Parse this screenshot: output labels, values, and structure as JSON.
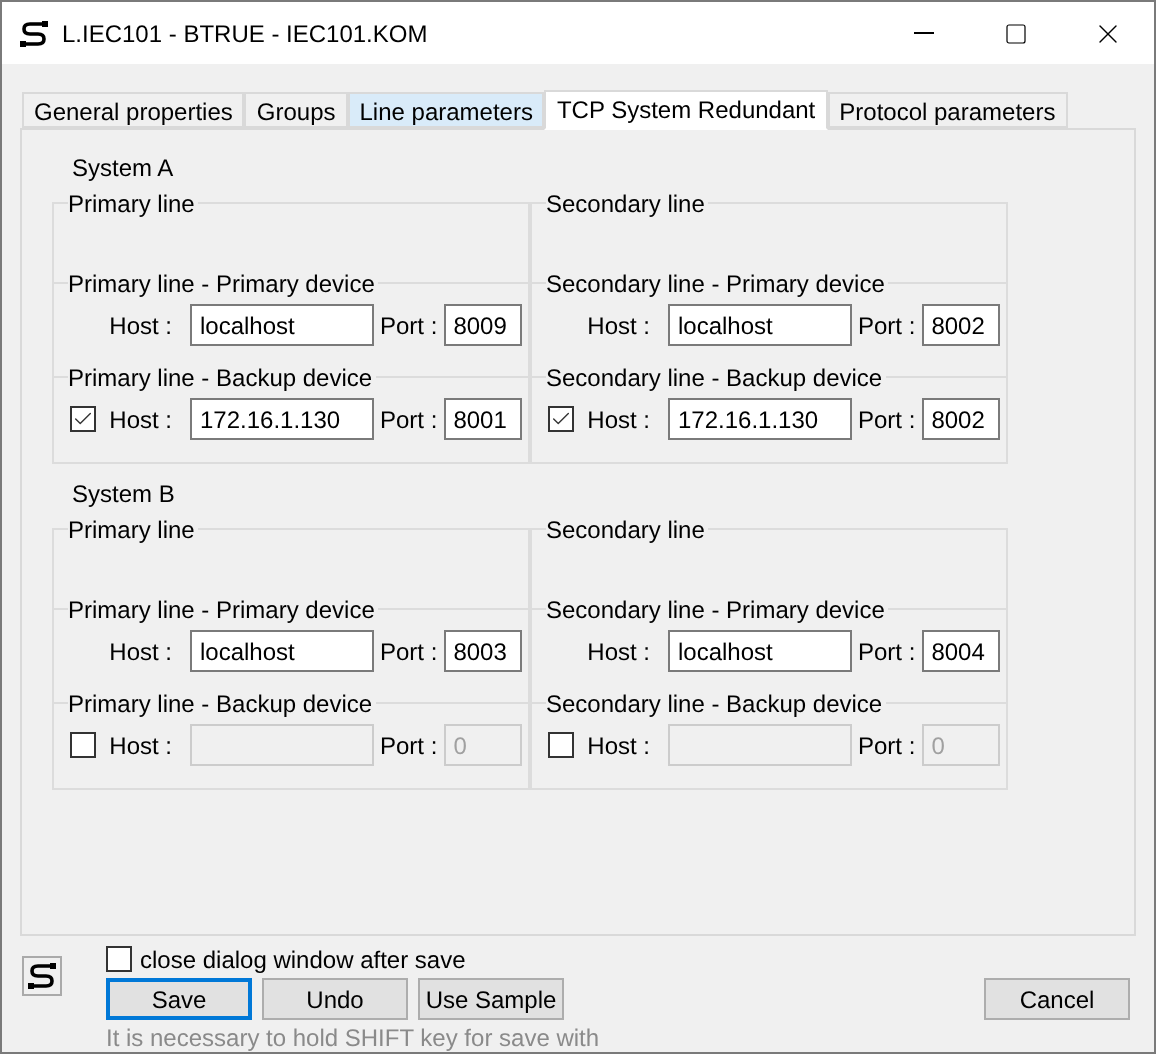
{
  "window": {
    "title": "L.IEC101 - BTRUE - IEC101.KOM"
  },
  "tabs": [
    {
      "label": "General properties",
      "selected": false,
      "highlighted": false
    },
    {
      "label": "Groups",
      "selected": false,
      "highlighted": false
    },
    {
      "label": "Line parameters",
      "selected": false,
      "highlighted": true
    },
    {
      "label": "TCP System Redundant",
      "selected": true,
      "highlighted": false
    },
    {
      "label": "Protocol parameters",
      "selected": false,
      "highlighted": false
    }
  ],
  "systems": [
    {
      "title": "System A",
      "lines": [
        {
          "title": "Primary line",
          "devices": [
            {
              "kind": "primary",
              "title": "Primary line - Primary device",
              "host_label": "Host :",
              "host": "localhost",
              "port_label": "Port :",
              "port": "8009"
            },
            {
              "kind": "backup",
              "title": "Primary line - Backup device",
              "checked": true,
              "host_label": "Host :",
              "host": "172.16.1.130",
              "port_label": "Port :",
              "port": "8001"
            }
          ]
        },
        {
          "title": "Secondary line",
          "devices": [
            {
              "kind": "primary",
              "title": "Secondary line - Primary device",
              "host_label": "Host :",
              "host": "localhost",
              "port_label": "Port :",
              "port": "8002"
            },
            {
              "kind": "backup",
              "title": "Secondary line - Backup device",
              "checked": true,
              "host_label": "Host :",
              "host": "172.16.1.130",
              "port_label": "Port :",
              "port": "8002"
            }
          ]
        }
      ]
    },
    {
      "title": "System B",
      "lines": [
        {
          "title": "Primary line",
          "devices": [
            {
              "kind": "primary",
              "title": "Primary line - Primary device",
              "host_label": "Host :",
              "host": "localhost",
              "port_label": "Port :",
              "port": "8003"
            },
            {
              "kind": "backup",
              "title": "Primary line - Backup device",
              "checked": false,
              "host_label": "Host :",
              "port_label": "Port :",
              "port": "0"
            }
          ]
        },
        {
          "title": "Secondary line",
          "devices": [
            {
              "kind": "primary",
              "title": "Secondary line - Primary device",
              "host_label": "Host :",
              "host": "localhost",
              "port_label": "Port :",
              "port": "8004"
            },
            {
              "kind": "backup",
              "title": "Secondary line - Backup device",
              "checked": false,
              "host_label": "Host :",
              "port_label": "Port :",
              "port": "0"
            }
          ]
        }
      ]
    }
  ],
  "close_after_save": {
    "label": "close dialog window after save",
    "checked": false
  },
  "buttons": [
    {
      "label": "Save",
      "focused": true
    },
    {
      "label": "Undo",
      "focused": false
    },
    {
      "label": "Use Sample",
      "focused": false
    }
  ],
  "cancel_button": {
    "label": "Cancel"
  },
  "hint": "It is necessary to hold SHIFT key for save with"
}
